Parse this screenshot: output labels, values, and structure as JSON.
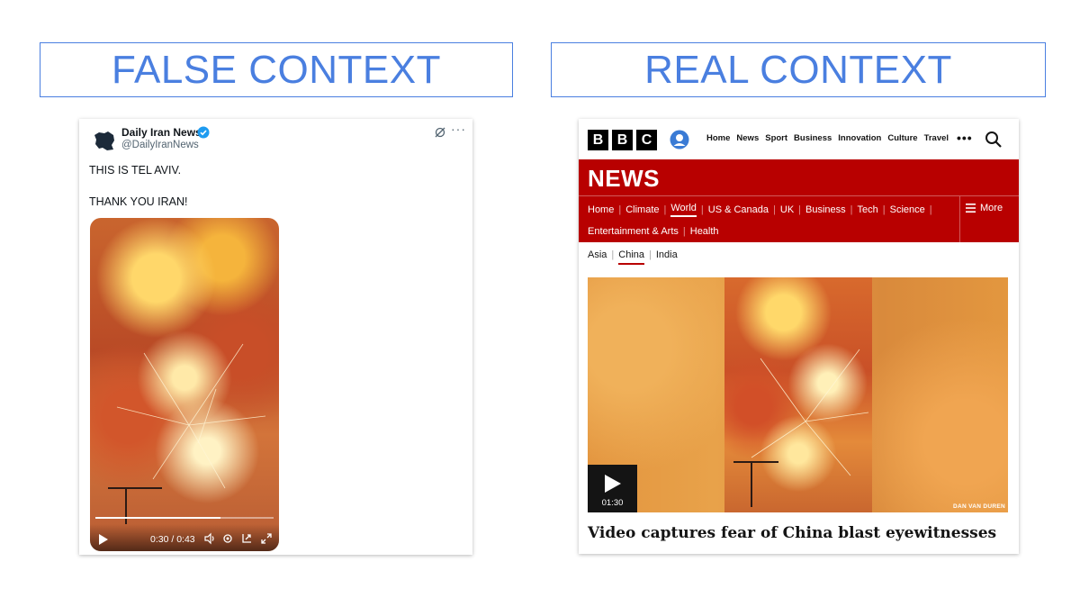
{
  "labels": {
    "left_heading": "FALSE CONTEXT",
    "right_heading": "REAL CONTEXT"
  },
  "tweet": {
    "display_name": "Daily Iran News",
    "handle": "@DailyIranNews",
    "text_line1": "THIS IS TEL AVIV.",
    "text_line2": "THANK YOU IRAN!",
    "more_label": "···",
    "video": {
      "time": "0:30 / 0:43",
      "progress": 0.7
    }
  },
  "bbc": {
    "logo_letters": [
      "B",
      "B",
      "C"
    ],
    "top_nav": [
      "Home",
      "News",
      "Sport",
      "Business",
      "Innovation",
      "Culture",
      "Travel"
    ],
    "top_more": "•••",
    "section_title": "NEWS",
    "nav_row1": [
      "Home",
      "Climate",
      "World",
      "US & Canada",
      "UK",
      "Business",
      "Tech",
      "Science"
    ],
    "nav_row2": [
      "Entertainment & Arts",
      "Health"
    ],
    "nav_active": "World",
    "more_label": "More",
    "sub_nav": [
      "Asia",
      "China",
      "India"
    ],
    "sub_active": "China",
    "video_duration": "01:30",
    "image_credit": "DAN VAN DUREN",
    "headline": "Video captures fear of China blast eyewitnesses",
    "brand_color": "#b80000"
  }
}
